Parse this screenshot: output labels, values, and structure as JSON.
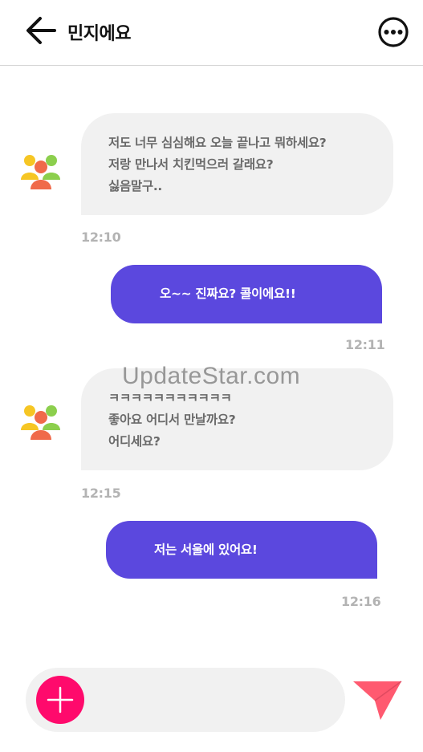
{
  "header": {
    "title": "민지에요",
    "back_icon": "arrow-left-icon",
    "more_icon": "more-options-icon"
  },
  "messages": [
    {
      "direction": "incoming",
      "lines": [
        "저도 너무 심심해요 오늘 끝나고 뭐하세요?",
        "저랑 만나서 치킨먹으러 갈래요?",
        "싫음말구.."
      ],
      "time": "12:10",
      "avatar_icon": "people-group-icon"
    },
    {
      "direction": "outgoing",
      "text": "오~~ 진짜요? 콜이에요!!",
      "time": "12:11"
    },
    {
      "direction": "incoming",
      "lines": [
        "ㅋㅋㅋㅋㅋㅋㅋㅋㅋㅋㅋ",
        "좋아요 어디서 만날까요?",
        "어디세요?"
      ],
      "time": "12:15",
      "avatar_icon": "people-group-icon"
    },
    {
      "direction": "outgoing",
      "text": "저는 서울에 있어요!",
      "time": "12:16"
    }
  ],
  "watermark": "UpdateStar.com",
  "composer": {
    "input_value": "",
    "add_icon": "plus-icon",
    "send_icon": "send-icon"
  },
  "colors": {
    "accent": "#5b48de",
    "add_button": "#ff0a6c",
    "send_icon": "#ff5a70",
    "bubble_incoming": "#f1f1f1",
    "timestamp": "#b3b3b3"
  }
}
